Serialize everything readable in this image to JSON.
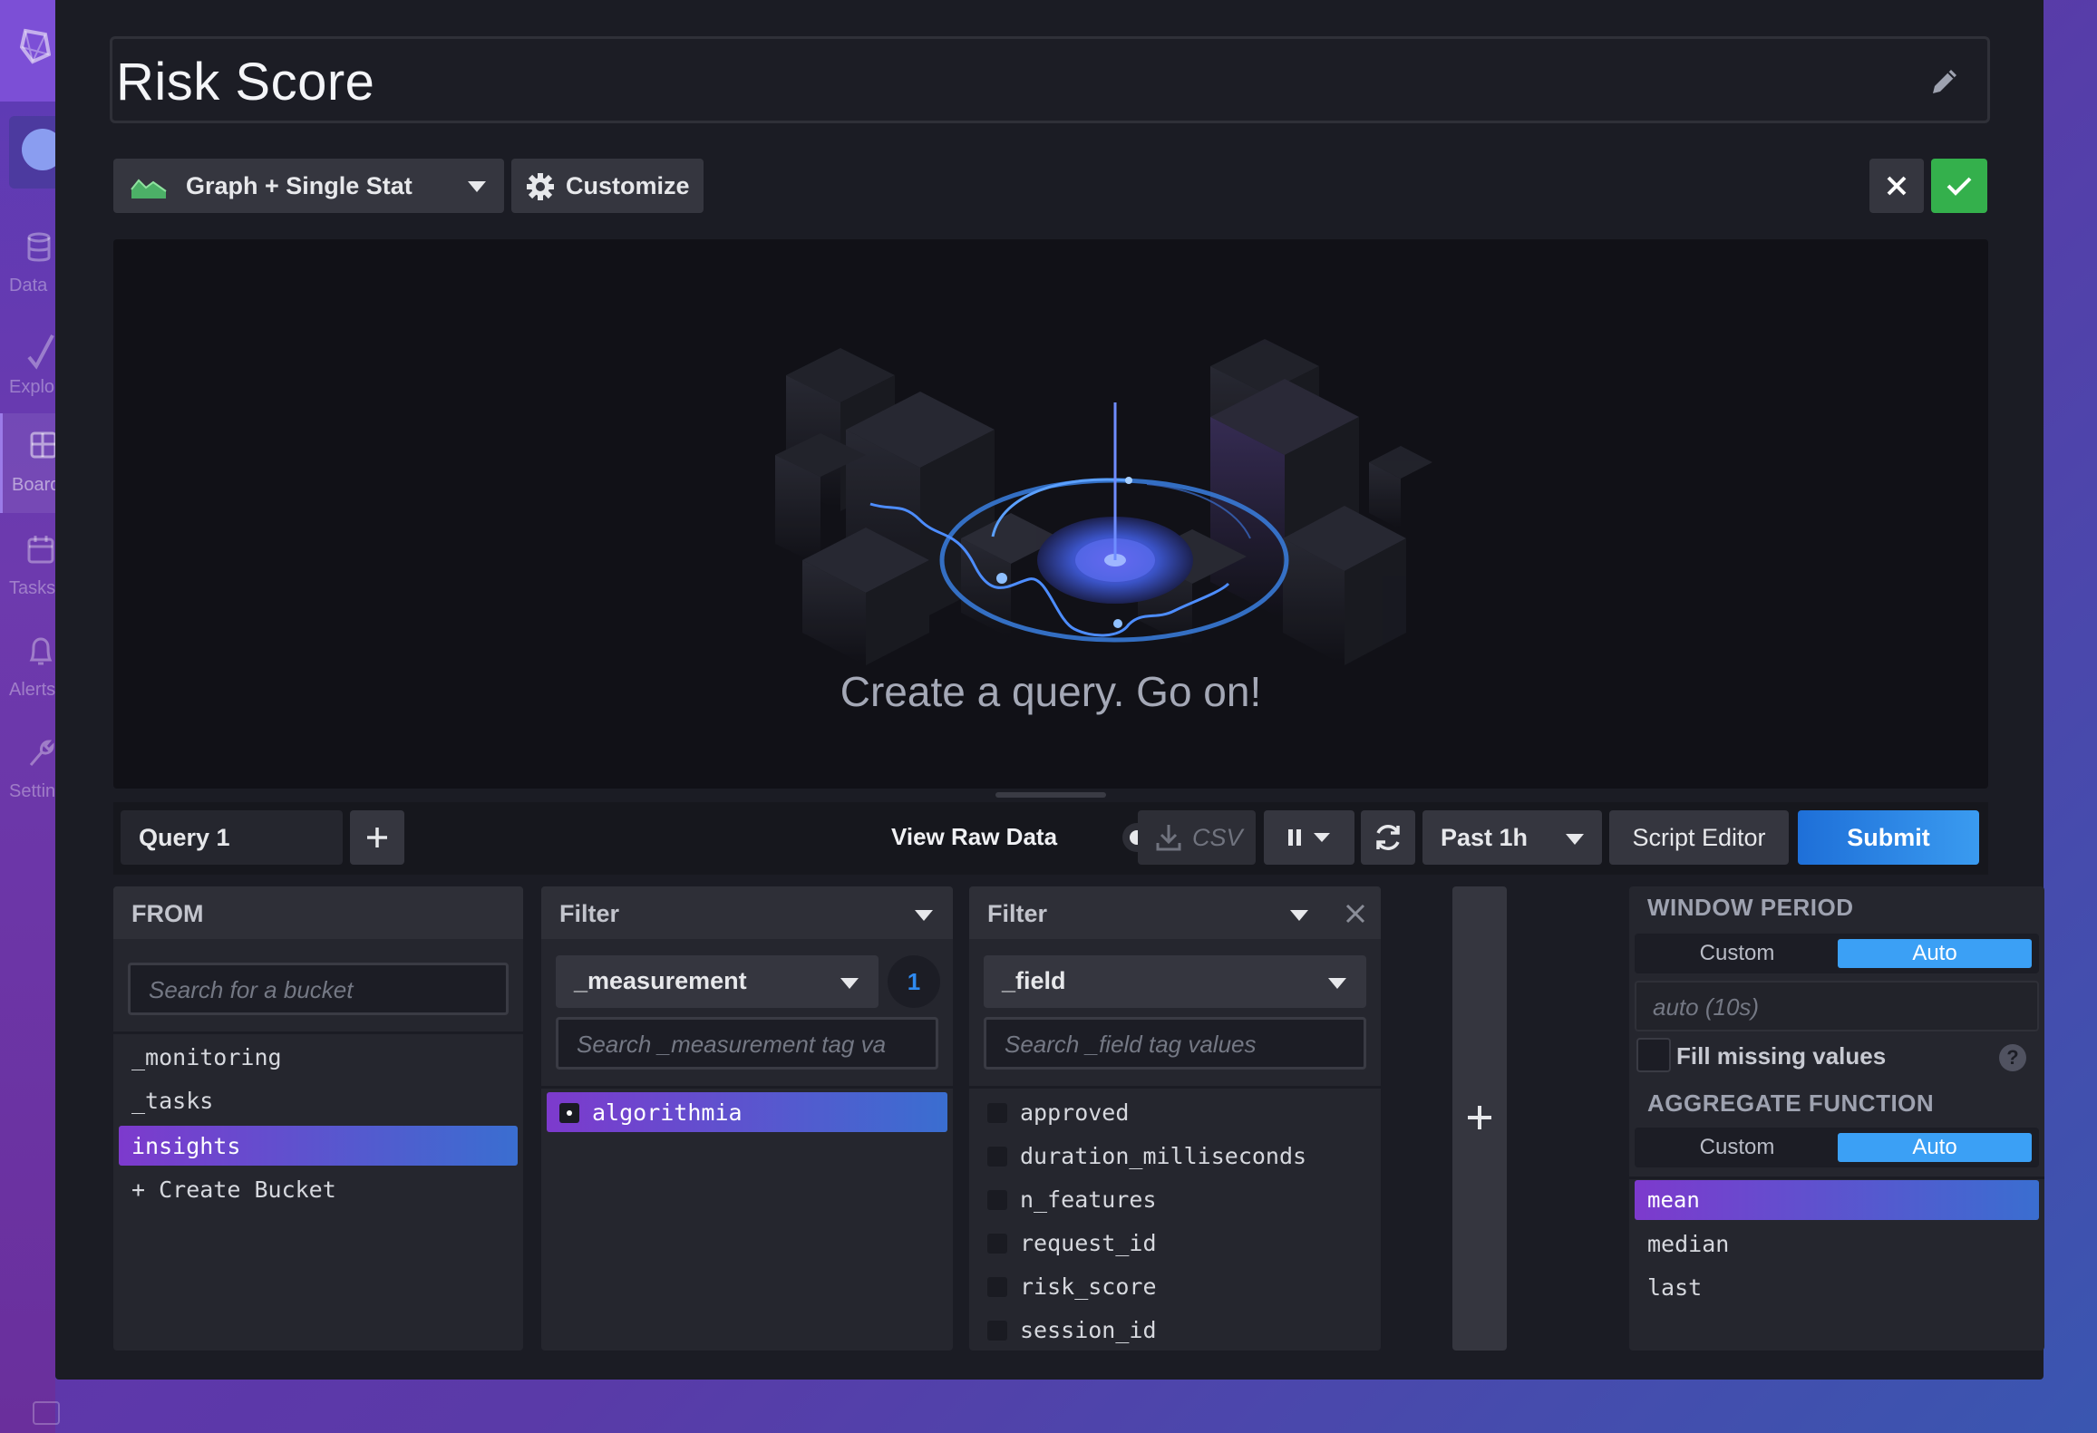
{
  "nav": {
    "items": [
      {
        "label": "Data",
        "icon": "database-icon"
      },
      {
        "label": "Explore",
        "icon": "graph-line-icon"
      },
      {
        "label": "Boards",
        "icon": "dashboards-icon"
      },
      {
        "label": "Tasks",
        "icon": "calendar-icon"
      },
      {
        "label": "Alerts",
        "icon": "bell-icon"
      },
      {
        "label": "Settings",
        "icon": "wrench-icon"
      }
    ],
    "active": "Boards"
  },
  "cell": {
    "name": "Risk Score"
  },
  "toolbar": {
    "vis_type": "Graph + Single Stat",
    "customize_label": "Customize"
  },
  "empty_state": {
    "message": "Create a query. Go on!"
  },
  "query_bar": {
    "query_tab": "Query 1",
    "add_query": "+",
    "view_raw_label": "View Raw Data",
    "csv_label": "CSV",
    "time_range": "Past 1h",
    "script_editor_label": "Script Editor",
    "submit_label": "Submit"
  },
  "from_card": {
    "header": "FROM",
    "search_placeholder": "Search for a bucket",
    "buckets": [
      "_monitoring",
      "_tasks",
      "insights",
      "+ Create Bucket"
    ],
    "selected": "insights"
  },
  "filter1": {
    "header": "Filter",
    "key": "_measurement",
    "selected_count": "1",
    "search_placeholder": "Search _measurement tag va",
    "values": [
      "algorithmia"
    ],
    "selected": "algorithmia"
  },
  "filter2": {
    "header": "Filter",
    "key": "_field",
    "search_placeholder": "Search _field tag values",
    "values": [
      "approved",
      "duration_milliseconds",
      "n_features",
      "request_id",
      "risk_score",
      "session_id"
    ]
  },
  "add_filter": "+",
  "window_period": {
    "header": "WINDOW PERIOD",
    "custom_label": "Custom",
    "auto_label": "Auto",
    "active": "Auto",
    "input_placeholder": "auto (10s)",
    "fill_missing_label": "Fill missing values",
    "help": "?"
  },
  "aggregate": {
    "header": "AGGREGATE FUNCTION",
    "custom_label": "Custom",
    "auto_label": "Auto",
    "active": "Auto",
    "functions": [
      "mean",
      "median",
      "last"
    ],
    "selected": "mean"
  },
  "colors": {
    "save": "#34b04c",
    "submit": "#2a85e6",
    "selected_gradient_start": "#7d3acd",
    "selected_gradient_end": "#3a6ed0",
    "auto_active": "#3ba0f5"
  }
}
